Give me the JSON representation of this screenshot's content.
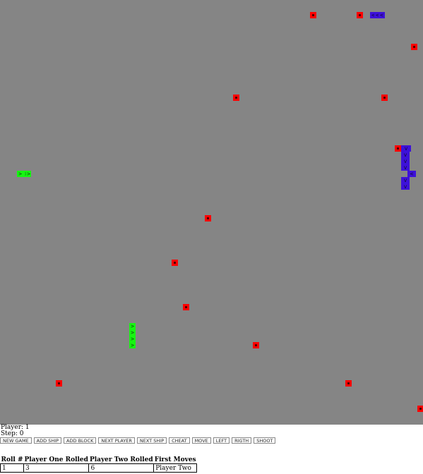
{
  "game_board": {
    "background_color": "#858585",
    "block_color": "#ff0000",
    "player_one_color": "#17f512",
    "player_two_color": "#3d11d9",
    "ship_glyphs": {
      "right": ">",
      "left": "<",
      "down": "v"
    }
  },
  "status": {
    "player_label": "Player:",
    "player_value": "1",
    "step_label": "Step:",
    "step_value": "0"
  },
  "buttons": {
    "new_game": "NEW GAME",
    "add_ship": "ADD SHIP",
    "add_block": "ADD BLOCK",
    "next_player": "NEXT PLAYER",
    "next_ship": "NEXT SHIP",
    "cheat": "CHEAT",
    "move": "MOVE",
    "left": "LEFT",
    "right": "RIGTH",
    "shoot": "SHOOT"
  },
  "roll_table": {
    "headers": [
      "Roll #",
      "Player One Rolled",
      "Player Two Rolled",
      "First Moves"
    ],
    "rows": [
      [
        "1",
        "3",
        "6",
        "Player Two"
      ]
    ]
  }
}
